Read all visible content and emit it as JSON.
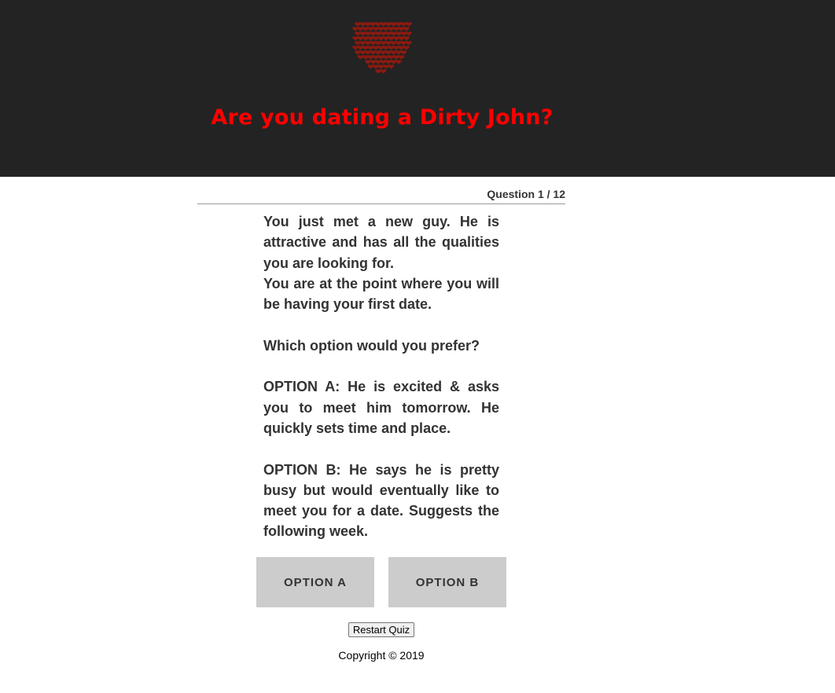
{
  "header": {
    "title": "Are you dating a Dirty John?",
    "logo_icon": "hearts-cluster-icon",
    "background": "#232323",
    "title_color": "#ff0000"
  },
  "quiz": {
    "counter": "Question 1 / 12",
    "question_lines": [
      "You just met a new guy. He is attractive and has all the qualities you are looking for.",
      "You are at the point where you will be having your first date."
    ],
    "prompt": "Which option would you prefer?",
    "option_a_text": "OPTION A: He is excited & asks you to meet him tomorrow. He quickly sets time and place.",
    "option_b_text": "OPTION B: He says he is pretty busy but would eventually like to meet you for a date. Suggests the following week.",
    "option_a_label": "OPTION A",
    "option_b_label": "OPTION B",
    "restart_label": "Restart Quiz"
  },
  "footer": {
    "copyright": "Copyright © 2019"
  }
}
